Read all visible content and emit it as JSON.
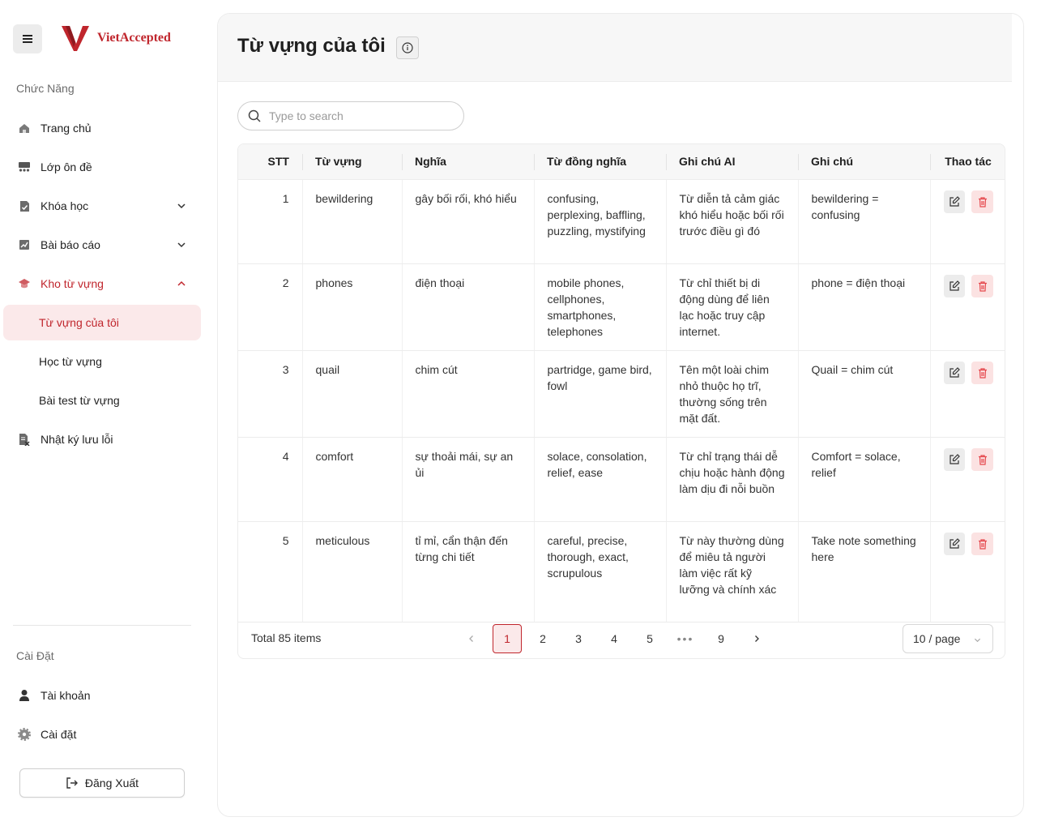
{
  "brand": {
    "name": "VietAccepted",
    "color": "#c0262d"
  },
  "sidebar": {
    "section_main": "Chức Năng",
    "items": [
      {
        "label": "Trang chủ",
        "icon": "home-icon"
      },
      {
        "label": "Lớp ôn đề",
        "icon": "classroom-icon"
      },
      {
        "label": "Khóa học",
        "icon": "course-icon",
        "expandable": true
      },
      {
        "label": "Bài báo cáo",
        "icon": "report-icon",
        "expandable": true
      },
      {
        "label": "Kho từ vựng",
        "icon": "graduation-cap-icon",
        "expanded": true
      },
      {
        "label": "Nhật ký lưu lỗi",
        "icon": "error-log-icon"
      }
    ],
    "sub_items": [
      {
        "label": "Từ vựng của tôi",
        "selected": true
      },
      {
        "label": "Học từ vựng"
      },
      {
        "label": "Bài test từ vựng"
      }
    ],
    "section_settings": "Cài Đặt",
    "settings_items": [
      {
        "label": "Tài khoản",
        "icon": "user-icon"
      },
      {
        "label": "Cài đặt",
        "icon": "gear-icon"
      }
    ],
    "logout_label": "Đăng Xuất"
  },
  "main": {
    "title": "Từ vựng của tôi",
    "search_placeholder": "Type to search",
    "table": {
      "headers": [
        "STT",
        "Từ vựng",
        "Nghĩa",
        "Từ đồng nghĩa",
        "Ghi chú AI",
        "Ghi chú",
        "Thao tác"
      ],
      "rows": [
        {
          "stt": "1",
          "word": "bewildering",
          "meaning": "gây bối rối, khó hiểu",
          "synonyms": "confusing, perplexing, baffling, puzzling, mystifying",
          "ai_note": "Từ diễn tả cảm giác khó hiểu hoặc bối rối trước điều gì đó",
          "note": "bewildering = confusing"
        },
        {
          "stt": "2",
          "word": "phones",
          "meaning": "điện thoại",
          "synonyms": "mobile phones, cellphones, smartphones, telephones",
          "ai_note": "Từ chỉ thiết bị di động dùng để liên lạc hoặc truy cập internet.",
          "note": "phone = điện thoại"
        },
        {
          "stt": "3",
          "word": "quail",
          "meaning": "chim cút",
          "synonyms": "partridge, game bird, fowl",
          "ai_note": "Tên một loài chim nhỏ thuộc họ trĩ, thường sống trên mặt đất.",
          "note": "Quail = chim cút"
        },
        {
          "stt": "4",
          "word": "comfort",
          "meaning": "sự thoải mái, sự an ủi",
          "synonyms": "solace, consolation, relief, ease",
          "ai_note": "Từ chỉ trạng thái dễ chịu hoặc hành động làm dịu đi nỗi buồn",
          "note": "Comfort = solace, relief"
        },
        {
          "stt": "5",
          "word": "meticulous",
          "meaning": "tỉ mỉ, cẩn thận đến từng chi tiết",
          "synonyms": "careful, precise, thorough, exact, scrupulous",
          "ai_note": "Từ này thường dùng để miêu tả người làm việc rất kỹ lưỡng và chính xác",
          "note": "Take note something here"
        }
      ]
    },
    "pagination": {
      "total": "Total 85 items",
      "pages": [
        "1",
        "2",
        "3",
        "4",
        "5",
        "•••",
        "9"
      ],
      "current": "1",
      "page_size": "10 / page"
    }
  }
}
